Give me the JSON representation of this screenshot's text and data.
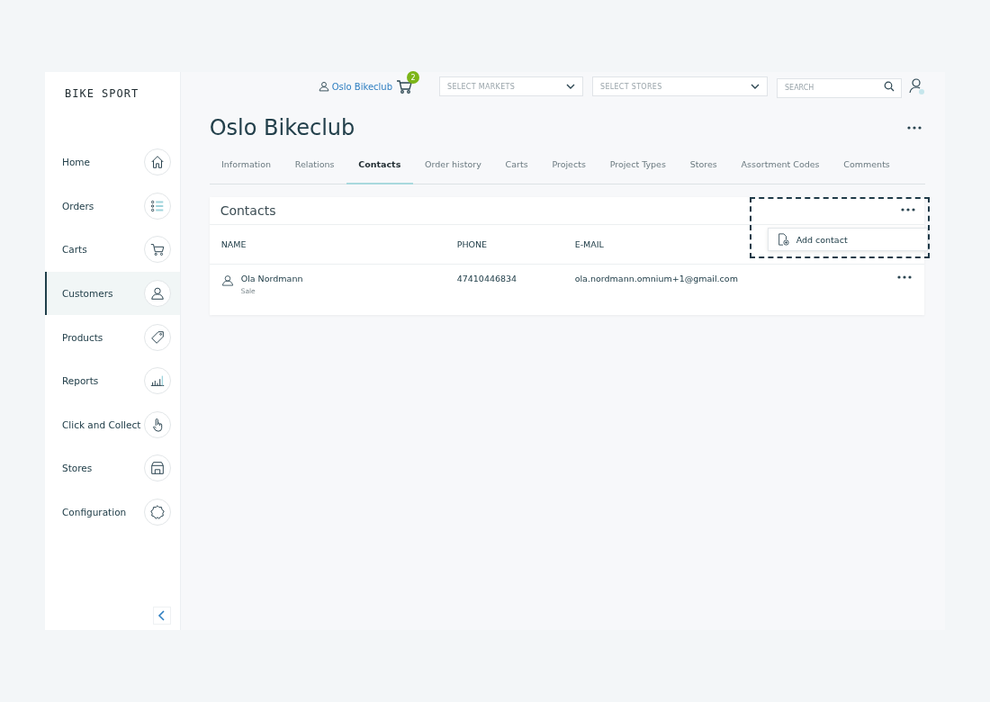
{
  "sidebar": {
    "logo": "BIKE SPORT",
    "items": [
      {
        "label": "Home",
        "kind": "home",
        "selected": false
      },
      {
        "label": "Orders",
        "kind": "orders",
        "selected": false
      },
      {
        "label": "Carts",
        "kind": "cart",
        "selected": false
      },
      {
        "label": "Customers",
        "kind": "customer",
        "selected": true
      },
      {
        "label": "Products",
        "kind": "tag",
        "selected": false
      },
      {
        "label": "Reports",
        "kind": "chart",
        "selected": false
      },
      {
        "label": "Click and Collect",
        "kind": "hand",
        "selected": false
      },
      {
        "label": "Stores",
        "kind": "store",
        "selected": false
      },
      {
        "label": "Configuration",
        "kind": "gear",
        "selected": false
      }
    ]
  },
  "header": {
    "customer": "Oslo Bikeclub",
    "cart_count": "2",
    "markets": {
      "placeholder": "SELECT MARKETS"
    },
    "stores": {
      "placeholder": "SELECT STORES"
    },
    "search": {
      "placeholder": "SEARCH"
    }
  },
  "page": {
    "title": "Oslo Bikeclub",
    "tabs": [
      {
        "label": "Information",
        "selected": false
      },
      {
        "label": "Relations",
        "selected": false
      },
      {
        "label": "Contacts",
        "selected": true
      },
      {
        "label": "Order history",
        "selected": false
      },
      {
        "label": "Carts",
        "selected": false
      },
      {
        "label": "Projects",
        "selected": false
      },
      {
        "label": "Project Types",
        "selected": false
      },
      {
        "label": "Stores",
        "selected": false
      },
      {
        "label": "Assortment Codes",
        "selected": false
      },
      {
        "label": "Comments",
        "selected": false
      }
    ]
  },
  "contacts": {
    "title": "Contacts",
    "menu": {
      "expanded": true,
      "items": [
        "Add contact"
      ]
    },
    "columns": [
      "NAME",
      "PHONE",
      "E-MAIL"
    ],
    "rows": [
      {
        "name": "Ola Nordmann",
        "role": "Sale",
        "phone": "47410446834",
        "email": "ola.nordmann.omnium+1@gmail.com"
      }
    ]
  }
}
